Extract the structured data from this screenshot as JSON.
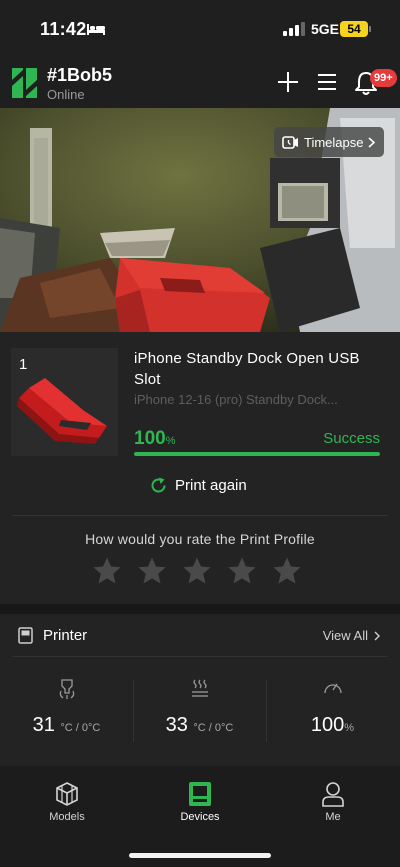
{
  "status_bar": {
    "time": "11:42",
    "network": "5GE",
    "battery": "54"
  },
  "header": {
    "printer_name": "#1Bob5",
    "printer_status": "Online",
    "notification_count": "99+",
    "icons": [
      "logo-icon",
      "plus-icon",
      "menu-icon",
      "bell-icon"
    ]
  },
  "camera": {
    "timelapse_label": "Timelapse"
  },
  "job": {
    "plate_number": "1",
    "title": "iPhone Standby Dock Open USB Slot",
    "subtitle": "iPhone 12-16 (pro) Standby Dock...",
    "progress_value": "100",
    "progress_unit": "%",
    "progress_fraction": 1.0,
    "status": "Success",
    "print_again_label": "Print again",
    "rating_question": "How would you rate the Print Profile",
    "rating_stars_total": 5,
    "rating_stars_filled": 0
  },
  "printer_panel": {
    "title": "Printer",
    "view_all_label": "View All",
    "metrics": [
      {
        "icon": "nozzle-temp-icon",
        "value": "31",
        "unit": "°C / 0°C"
      },
      {
        "icon": "bed-temp-icon",
        "value": "33",
        "unit": "°C / 0°C"
      },
      {
        "icon": "speed-gauge-icon",
        "value": "100",
        "unit": "%"
      }
    ]
  },
  "tabs": [
    {
      "label": "Models",
      "icon": "models-icon",
      "active": false
    },
    {
      "label": "Devices",
      "icon": "devices-icon",
      "active": true
    },
    {
      "label": "Me",
      "icon": "profile-icon",
      "active": false
    }
  ],
  "colors": {
    "accent": "#2fb552",
    "badge": "#e53b3b",
    "battery": "#f6d31e",
    "background": "#1f1f1f"
  }
}
